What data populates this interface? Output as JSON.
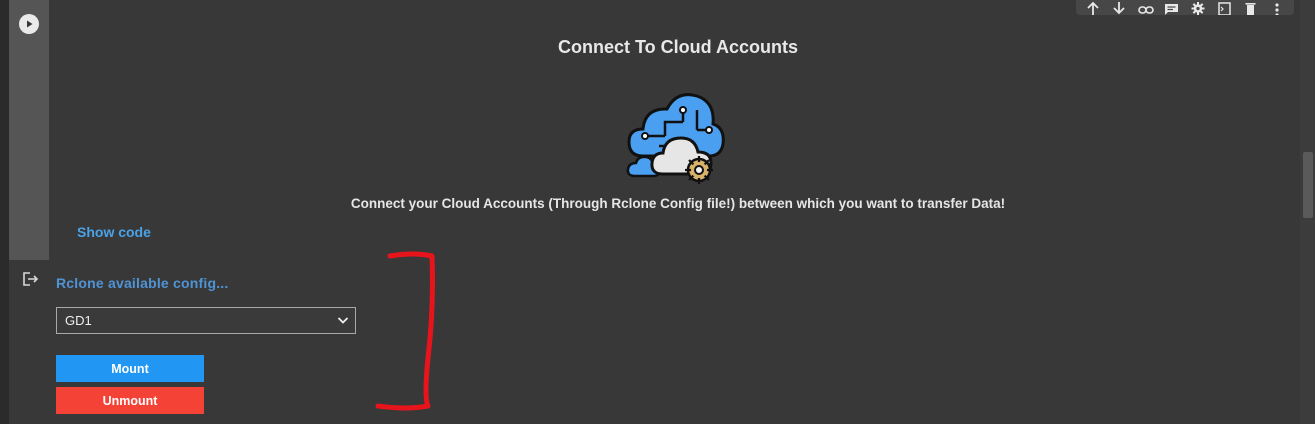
{
  "cell": {
    "title": "Connect To Cloud Accounts",
    "subtitle": "Connect your Cloud Accounts (Through Rclone Config file!) between which you want to transfer Data!",
    "show_code_label": "Show code"
  },
  "toolbar": {
    "icons": [
      "move-up-icon",
      "move-down-icon",
      "link-icon",
      "comment-icon",
      "gear-icon",
      "open-editor-icon",
      "delete-icon",
      "more-icon"
    ]
  },
  "form": {
    "label": "Rclone available config...",
    "select_value": "GD1",
    "mount_label": "Mount",
    "unmount_label": "Unmount"
  },
  "colors": {
    "background": "#383838",
    "accent_blue": "#2196f3",
    "accent_red": "#f44336",
    "link_blue": "#4aa3e8",
    "annotation_red": "#e8141b"
  }
}
